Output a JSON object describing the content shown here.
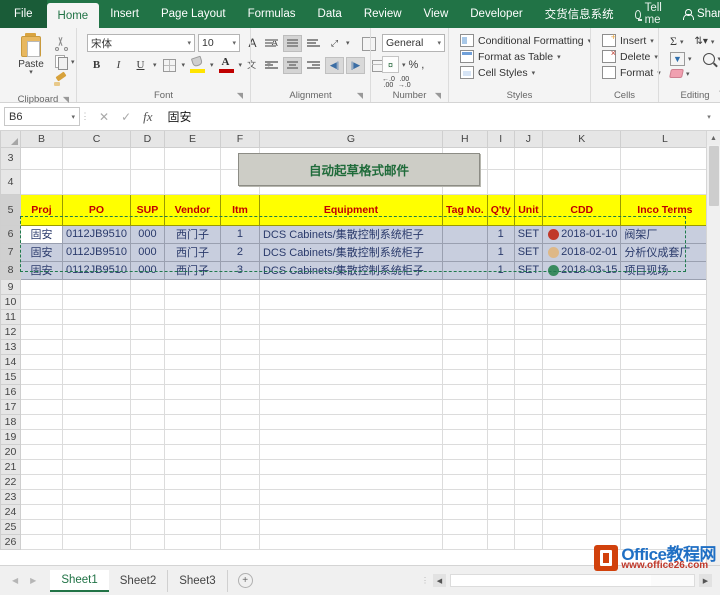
{
  "ribbon_tabs": {
    "file": "File",
    "items": [
      "Home",
      "Insert",
      "Page Layout",
      "Formulas",
      "Data",
      "Review",
      "View",
      "Developer",
      "交货信息系统"
    ],
    "active": "Home",
    "tell_me": "Tell me",
    "share": "Share"
  },
  "ribbon": {
    "groups": {
      "clipboard": {
        "label": "Clipboard",
        "paste": "Paste",
        "cut": "Cut",
        "copy": "Copy",
        "format_painter": "Format Painter"
      },
      "font": {
        "label": "Font",
        "font_name": "宋体",
        "font_size": "10",
        "grow": "A",
        "shrink": "A",
        "bold": "B",
        "italic": "I",
        "underline": "U",
        "borders": "Borders",
        "fill_color": "Fill Color",
        "font_color": "A",
        "phonetic": "Phonetic Guide"
      },
      "alignment": {
        "label": "Alignment",
        "align_top": "Top Align",
        "align_middle": "Middle Align",
        "align_bottom": "Bottom Align",
        "orientation": "Orientation",
        "align_left": "Align Left",
        "align_center": "Center",
        "align_right": "Align Right",
        "decrease_indent": "Decrease Indent",
        "increase_indent": "Increase Indent",
        "wrap_text": "Wrap Text",
        "merge_center": "Merge & Center"
      },
      "number": {
        "label": "Number",
        "format": "General",
        "accounting": "Accounting Number Format",
        "percent": "%",
        "comma": ",",
        "increase_decimal": "Increase Decimal",
        "decrease_decimal": "Decrease Decimal"
      },
      "styles": {
        "label": "Styles",
        "conditional_formatting": "Conditional Formatting",
        "format_as_table": "Format as Table",
        "cell_styles": "Cell Styles"
      },
      "cells": {
        "label": "Cells",
        "insert": "Insert",
        "delete": "Delete",
        "format": "Format"
      },
      "editing": {
        "label": "Editing",
        "autosum": "Σ",
        "fill": "Fill",
        "clear": "Clear",
        "sort_filter": "Sort & Filter",
        "find_select": "Find & Select"
      }
    }
  },
  "formula_bar": {
    "name_box": "B6",
    "cancel": "✕",
    "enter": "✓",
    "fx": "fx",
    "value": "固安"
  },
  "grid": {
    "columns": [
      "B",
      "C",
      "D",
      "E",
      "F",
      "G",
      "H",
      "I",
      "J",
      "K",
      "L"
    ],
    "rows": [
      3,
      4,
      5,
      6,
      7,
      8,
      9,
      10,
      11,
      12,
      13,
      14,
      15,
      16,
      17,
      18,
      19,
      20,
      21,
      22,
      23,
      24,
      25,
      26
    ],
    "title_button": "自动起草格式邮件",
    "headers": [
      "Proj",
      "PO",
      "SUP",
      "Vendor",
      "Itm",
      "Equipment",
      "Tag No.",
      "Q'ty",
      "Unit",
      "CDD",
      "Inco Terms"
    ],
    "data": [
      {
        "proj": "固安",
        "po": "0112JB9510",
        "sup": "000",
        "vendor": "西门子",
        "itm": "1",
        "equipment": "DCS Cabinets/集散控制系统柜子",
        "tag_no": "",
        "qty": "1",
        "unit": "SET",
        "cdd": "2018-01-10",
        "cdd_color": "#c0392b",
        "inco_terms": "阀架厂"
      },
      {
        "proj": "固安",
        "po": "0112JB9510",
        "sup": "000",
        "vendor": "西门子",
        "itm": "2",
        "equipment": "DCS Cabinets/集散控制系统柜子",
        "tag_no": "",
        "qty": "1",
        "unit": "SET",
        "cdd": "2018-02-01",
        "cdd_color": "#deb887",
        "inco_terms": "分析仪成套厂"
      },
      {
        "proj": "固安",
        "po": "0112JB9510",
        "sup": "000",
        "vendor": "西门子",
        "itm": "3",
        "equipment": "DCS Cabinets/集散控制系统柜子",
        "tag_no": "",
        "qty": "1",
        "unit": "SET",
        "cdd": "2018-03-15",
        "cdd_color": "#3a8b5f",
        "inco_terms": "项目现场"
      }
    ]
  },
  "sheet_tabs": {
    "items": [
      "Sheet1",
      "Sheet2",
      "Sheet3"
    ],
    "active": "Sheet1",
    "add": "+"
  },
  "watermark": {
    "title": "Office教程网",
    "url": "www.office26.com"
  },
  "colors": {
    "ribbon_green": "#217346",
    "header_yellow": "#ffff00",
    "header_red": "#c00000",
    "selection_blue": "#c8cede"
  }
}
